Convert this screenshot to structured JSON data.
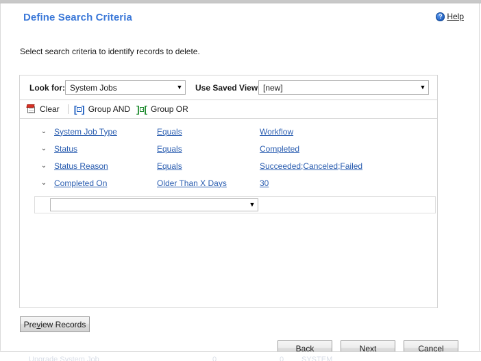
{
  "header": {
    "title": "Define Search Criteria",
    "help_label": "Help",
    "help_icon": "help-circle-icon",
    "help_glyph": "?"
  },
  "instruction": "Select search criteria to identify records to delete.",
  "criteria_panel": {
    "look_for": {
      "label": "Look for:",
      "value": "System Jobs",
      "arrow": "▼"
    },
    "saved_view": {
      "label": "Use Saved View:",
      "value": "[new]",
      "arrow": "▼"
    },
    "toolbar": {
      "clear_label": "Clear",
      "clear_icon": "clear-page-icon",
      "group_and_label": "Group AND",
      "group_and_icon": "group-and-brackets-icon",
      "group_or_label": "Group OR",
      "group_or_icon": "group-or-brackets-icon"
    },
    "chevron": "⌄",
    "rows": [
      {
        "field": "System Job Type",
        "operator": "Equals",
        "value": "Workflow"
      },
      {
        "field": "Status",
        "operator": "Equals",
        "value": "Completed"
      },
      {
        "field": "Status Reason",
        "operator": "Equals",
        "value": "Succeeded;Canceled;Failed"
      },
      {
        "field": "Completed On",
        "operator": "Older Than X Days",
        "value": "30"
      }
    ],
    "new_criteria": {
      "value": "",
      "placeholder": "",
      "arrow": "▼"
    }
  },
  "buttons": {
    "preview_records": {
      "pre": "Pre",
      "accel": "v",
      "post": "iew Records"
    },
    "back": {
      "pre": "",
      "accel": "B",
      "post": "ack"
    },
    "next": {
      "pre": "Ne",
      "accel": "x",
      "post": "t"
    },
    "cancel": {
      "pre": "",
      "accel": "C",
      "post": "ancel"
    }
  },
  "colors": {
    "title_blue": "#3b78d8",
    "link_blue": "#2a5db0",
    "group_and_blue": "#1f5fc0",
    "group_or_green": "#1d8a2e",
    "clear_red": "#d93025",
    "panel_border": "#d4d4d4"
  },
  "background_window": {
    "col1": "Upgrade System Job",
    "col2": "0",
    "col3": "0",
    "col4": "SYSTEM"
  }
}
